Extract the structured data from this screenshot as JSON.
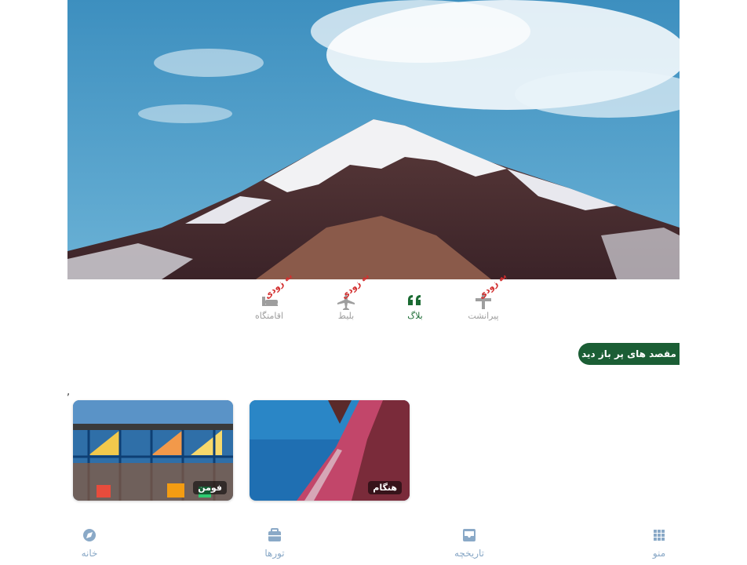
{
  "quick_links": [
    {
      "label": "اقامتگاه",
      "icon": "bed-icon",
      "badge": "به زودی"
    },
    {
      "label": "بلیط",
      "icon": "plane-icon",
      "badge": "به زودی"
    },
    {
      "label": "بلاگ",
      "icon": "quote-icon",
      "badge": ""
    },
    {
      "label": "پیرانشت",
      "icon": "tool-icon",
      "badge": "به زودی"
    }
  ],
  "section": {
    "title": "مقصد های پر باز دید",
    "stray_mark": ","
  },
  "destinations": [
    {
      "name": "فومن"
    },
    {
      "name": "هنگام"
    }
  ],
  "bottom_nav": [
    {
      "label": "خانه",
      "icon": "compass-icon"
    },
    {
      "label": "تورها",
      "icon": "briefcase-icon"
    },
    {
      "label": "تاریخچه",
      "icon": "inbox-icon"
    },
    {
      "label": "منو",
      "icon": "grid-icon"
    }
  ],
  "colors": {
    "accent": "#1b5e35",
    "nav": "#8aa9c7",
    "badge": "#d32f2f"
  }
}
